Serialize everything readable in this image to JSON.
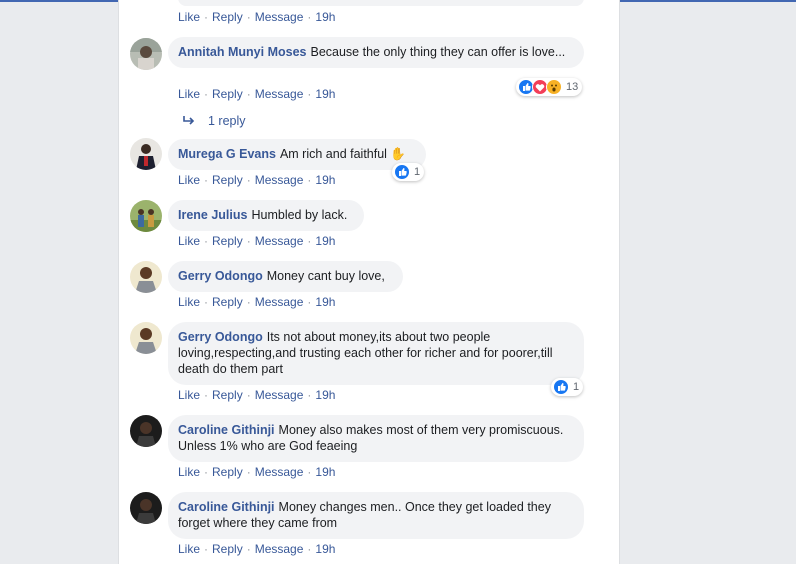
{
  "actions": {
    "like": "Like",
    "reply": "Reply",
    "message": "Message",
    "sep": "·"
  },
  "top_actions": {
    "time": "19h"
  },
  "comments": [
    {
      "name": "Annitah Munyi Moses",
      "text": "Because the only thing they can offer is love...",
      "time": "19h",
      "reactions": {
        "types": [
          "like-icon",
          "love-icon",
          "wow-icon"
        ],
        "count": "13"
      },
      "replies_label": "1 reply"
    },
    {
      "name": "Murega G Evans",
      "text": "Am rich and faithful ✋",
      "time": "19h",
      "reactions": {
        "types": [
          "like-icon"
        ],
        "count": "1"
      }
    },
    {
      "name": "Irene Julius",
      "text": "Humbled by lack.",
      "time": "19h"
    },
    {
      "name": "Gerry Odongo",
      "text": "Money cant buy love,",
      "time": "19h"
    },
    {
      "name": "Gerry Odongo",
      "text": "Its not about money,its about two people loving,respecting,and trusting each other for richer and for poorer,till death do them part",
      "time": "19h",
      "reactions": {
        "types": [
          "like-icon"
        ],
        "count": "1"
      }
    },
    {
      "name": "Caroline Githinji",
      "text": "Money also makes most of them very promiscuous. Unless 1% who are God feaeing",
      "time": "19h"
    },
    {
      "name": "Caroline Githinji",
      "text": "Money changes men.. Once they get loaded they forget where they came from",
      "time": "19h"
    }
  ],
  "colors": {
    "link": "#385898",
    "bubble": "#f2f3f5",
    "like": "#1877f2",
    "love": "#f33e58",
    "wow": "#f7b125"
  }
}
